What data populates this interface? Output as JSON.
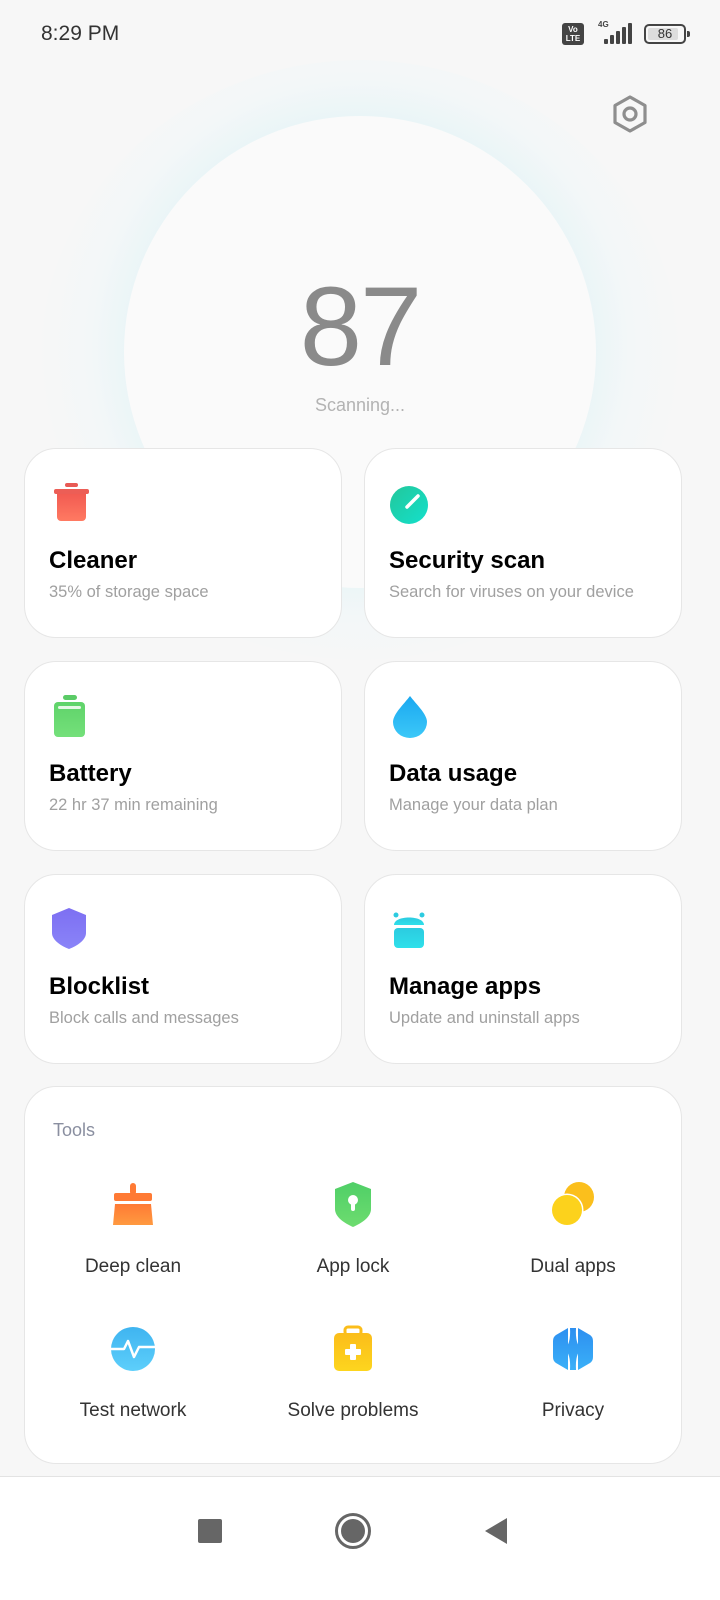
{
  "status_bar": {
    "time": "8:29 PM",
    "volte_label": "Vo LTE",
    "network_type": "4G",
    "battery_level": "86",
    "icons": [
      "volte-icon",
      "signal-icon",
      "battery-icon"
    ]
  },
  "header": {
    "settings_icon": "settings-hexagon-icon"
  },
  "score": {
    "value": "87",
    "status": "Scanning..."
  },
  "cards": [
    {
      "id": "cleaner",
      "title": "Cleaner",
      "subtitle": "35% of storage space",
      "icon": "trash-icon",
      "color": "#ff6b5b"
    },
    {
      "id": "security-scan",
      "title": "Security scan",
      "subtitle": "Search for viruses on your device",
      "icon": "security-gauge-icon",
      "color": "#1fd6b0"
    },
    {
      "id": "battery",
      "title": "Battery",
      "subtitle": "22 hr 37 min  remaining",
      "icon": "battery-icon",
      "color": "#66d966"
    },
    {
      "id": "data-usage",
      "title": "Data usage",
      "subtitle": "Manage your data plan",
      "icon": "water-drop-icon",
      "color": "#2ab8f5"
    },
    {
      "id": "blocklist",
      "title": "Blocklist",
      "subtitle": "Block calls and messages",
      "icon": "shield-icon",
      "color": "#7f7af5"
    },
    {
      "id": "manage-apps",
      "title": "Manage apps",
      "subtitle": "Update and uninstall apps",
      "icon": "android-icon",
      "color": "#2ad8e8"
    }
  ],
  "tools": {
    "label": "Tools",
    "items": [
      {
        "id": "deep-clean",
        "label": "Deep clean",
        "icon": "brush-icon",
        "color": "#ff8a3a"
      },
      {
        "id": "app-lock",
        "label": "App lock",
        "icon": "lock-shield-icon",
        "color": "#5bd86a"
      },
      {
        "id": "dual-apps",
        "label": "Dual apps",
        "icon": "dual-circles-icon",
        "color": "#fcc419"
      },
      {
        "id": "test-network",
        "label": "Test network",
        "icon": "network-pulse-icon",
        "color": "#4fc3f7"
      },
      {
        "id": "solve-problems",
        "label": "Solve problems",
        "icon": "first-aid-kit-icon",
        "color": "#fcc419"
      },
      {
        "id": "privacy",
        "label": "Privacy",
        "icon": "privacy-hexagon-icon",
        "color": "#2e9cf5"
      }
    ]
  },
  "nav": {
    "recents": "recents-square-icon",
    "home": "home-circle-icon",
    "back": "back-triangle-icon"
  }
}
